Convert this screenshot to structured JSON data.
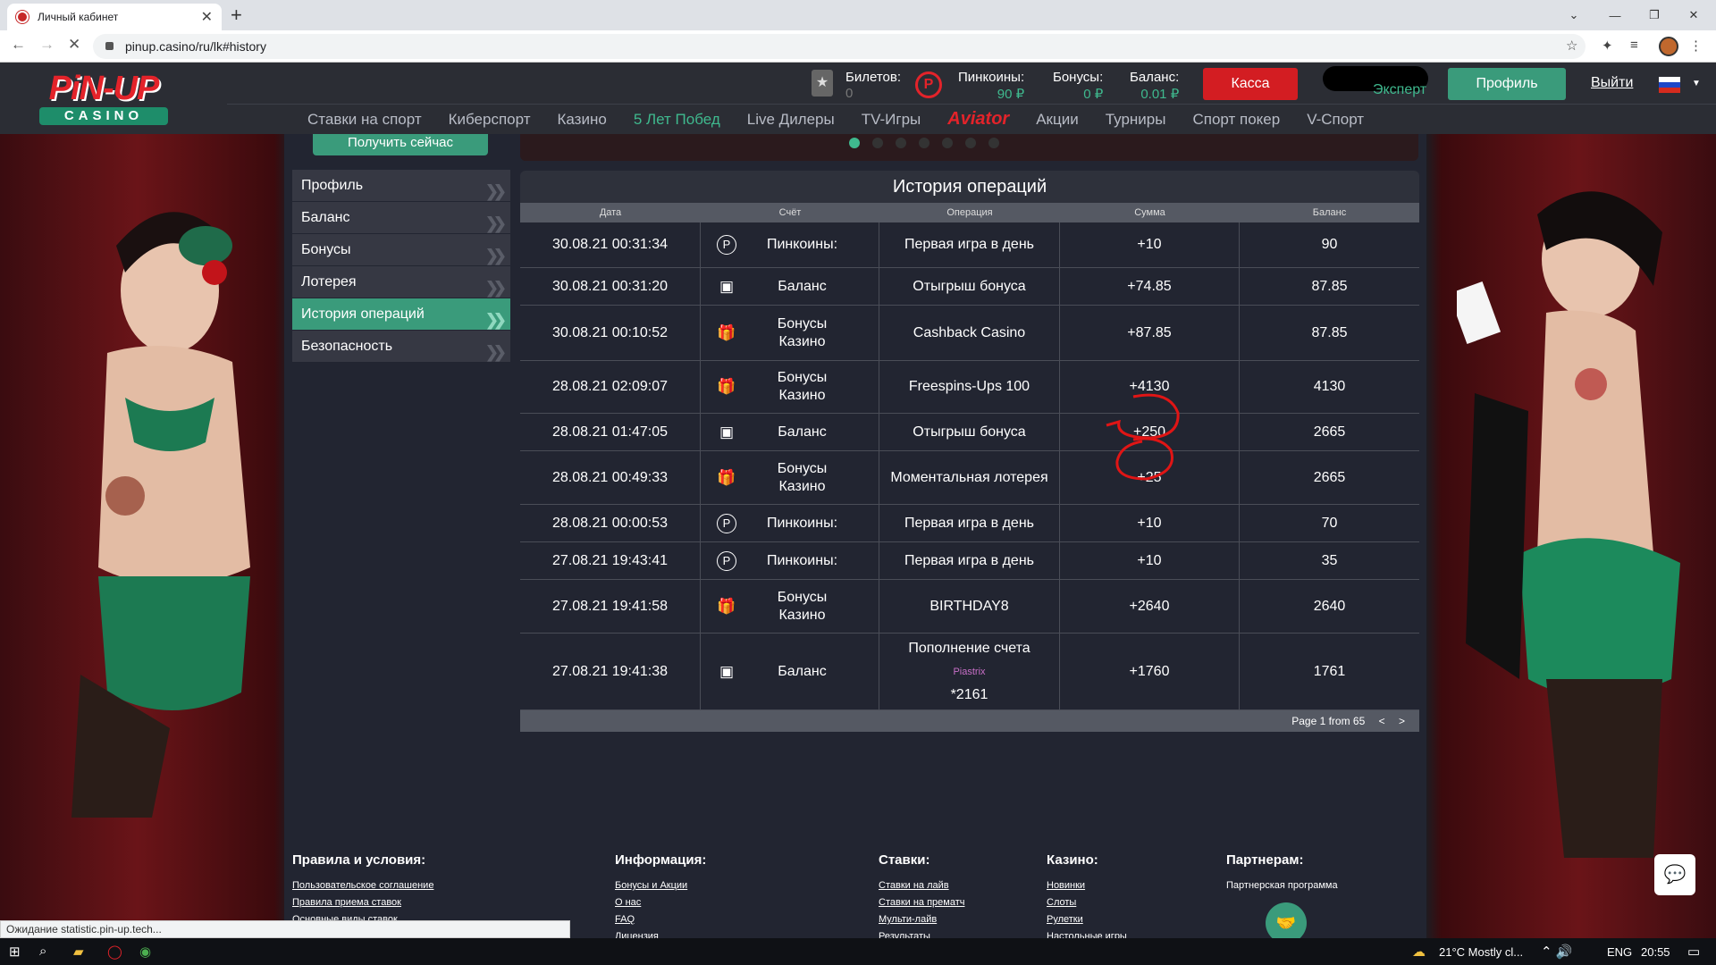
{
  "browser": {
    "tab_title": "Личный кабинет",
    "url": "pinup.casino/ru/lk#history",
    "status_text": "Ожидание statistic.pin-up.tech..."
  },
  "header": {
    "logo_word": "PiN-UP",
    "logo_sub": "CASINO",
    "tickets_label": "Билетов:",
    "tickets_value": "0",
    "pincoins_label": "Пинкоины:",
    "pincoins_value": "90 ₽",
    "bonuses_label": "Бонусы:",
    "bonuses_value": "0 ₽",
    "balance_label": "Баланс:",
    "balance_value": "0.01 ₽",
    "kassa_label": "Касса",
    "level_label": "Эксперт",
    "profile_label": "Профиль",
    "logout_label": "Выйти"
  },
  "nav": [
    "Ставки на спорт",
    "Киберспорт",
    "Казино",
    "5 Лет Побед",
    "Live Дилеры",
    "TV-Игры",
    "Aviator",
    "Акции",
    "Турниры",
    "Спорт покер",
    "V-Спорт"
  ],
  "promo_button": "Получить сейчас",
  "sidemenu": [
    "Профиль",
    "Баланс",
    "Бонусы",
    "Лотерея",
    "История операций",
    "Безопасность"
  ],
  "history": {
    "title": "История операций",
    "columns": [
      "Дата",
      "Счёт",
      "Операция",
      "Сумма",
      "Баланс"
    ],
    "rows": [
      {
        "date": "30.08.21 00:31:34",
        "account": "Пинкоины:",
        "icon": "pincoin-icon",
        "operation": "Первая игра в день",
        "sum": "+10",
        "balance": "90"
      },
      {
        "date": "30.08.21 00:31:20",
        "account": "Баланс",
        "icon": "cash-icon",
        "operation": "Отыгрыш бонуса",
        "sum": "+74.85",
        "balance": "87.85"
      },
      {
        "date": "30.08.21 00:10:52",
        "account": "Бонусы Казино",
        "icon": "gift-icon",
        "operation": "Cashback Casino",
        "sum": "+87.85",
        "balance": "87.85"
      },
      {
        "date": "28.08.21 02:09:07",
        "account": "Бонусы Казино",
        "icon": "gift-icon",
        "operation": "Freespins-Ups 100",
        "sum": "+4130",
        "balance": "4130"
      },
      {
        "date": "28.08.21 01:47:05",
        "account": "Баланс",
        "icon": "cash-icon",
        "operation": "Отыгрыш бонуса",
        "sum": "+250",
        "balance": "2665"
      },
      {
        "date": "28.08.21 00:49:33",
        "account": "Бонусы Казино",
        "icon": "gift-icon",
        "operation": "Моментальная лотерея",
        "sum": "+25",
        "balance": "2665"
      },
      {
        "date": "28.08.21 00:00:53",
        "account": "Пинкоины:",
        "icon": "pincoin-icon",
        "operation": "Первая игра в день",
        "sum": "+10",
        "balance": "70"
      },
      {
        "date": "27.08.21 19:43:41",
        "account": "Пинкоины:",
        "icon": "pincoin-icon",
        "operation": "Первая игра в день",
        "sum": "+10",
        "balance": "35"
      },
      {
        "date": "27.08.21 19:41:58",
        "account": "Бонусы Казино",
        "icon": "gift-icon",
        "operation": "BIRTHDAY8",
        "sum": "+2640",
        "balance": "2640"
      },
      {
        "date": "27.08.21 19:41:38",
        "account": "Баланс",
        "icon": "cash-icon",
        "operation": "Пополнение счета",
        "operation_sub": "Piastrix",
        "operation_card": "*2161",
        "sum": "+1760",
        "balance": "1761"
      }
    ],
    "pagination": "Page 1 from 65",
    "prev": "<",
    "next": ">"
  },
  "footer": {
    "terms": {
      "title": "Правила и условия:",
      "links": [
        "Пользовательское соглашение",
        "Правила приема ставок",
        "Основные виды ставок"
      ]
    },
    "info": {
      "title": "Информация:",
      "links": [
        "Бонусы и Акции",
        "О нас",
        "FAQ",
        "Лицензия"
      ]
    },
    "bets": {
      "title": "Ставки:",
      "links": [
        "Ставки на лайв",
        "Ставки на прематч",
        "Мульти-лайв",
        "Результаты"
      ]
    },
    "casino": {
      "title": "Казино:",
      "links": [
        "Новинки",
        "Слоты",
        "Рулетки",
        "Настольные игры"
      ]
    },
    "partners": {
      "title": "Партнерам:",
      "links": [
        "Партнерская программа"
      ]
    }
  },
  "taskbar": {
    "weather": "21°C  Mostly cl...",
    "lang": "ENG",
    "time": "20:55"
  },
  "colors": {
    "accent": "#3a9b7b",
    "brand_red": "#d31d22",
    "annotation": "#e01515"
  }
}
